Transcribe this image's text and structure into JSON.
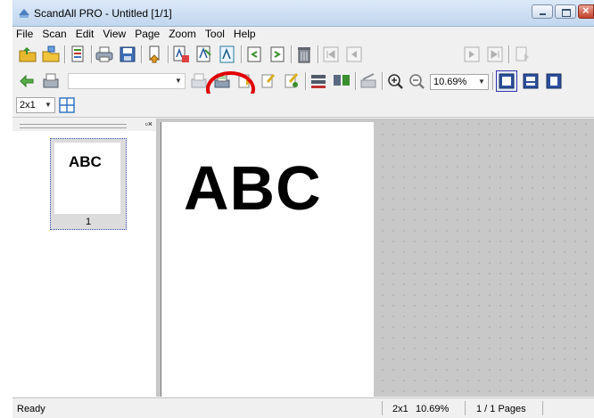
{
  "window": {
    "title": "ScandAll PRO - Untitled [1/1]"
  },
  "menu": [
    "File",
    "Scan",
    "Edit",
    "View",
    "Page",
    "Zoom",
    "Tool",
    "Help"
  ],
  "toolbar": {
    "page_number": "1",
    "zoom_value": "10.69%",
    "layout_value": "2x1"
  },
  "thumbnail": {
    "text": "ABC",
    "page_number": "1"
  },
  "document": {
    "text": "ABC"
  },
  "status": {
    "ready": "Ready",
    "layout": "2x1",
    "zoom": "10.69%",
    "pages": "1 / 1 Pages"
  },
  "colors": {
    "highlight": "#e00000"
  }
}
